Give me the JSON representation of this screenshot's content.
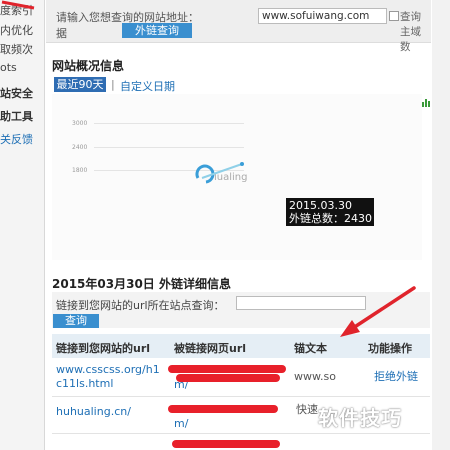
{
  "sidebar": {
    "items": [
      {
        "label": "度索引"
      },
      {
        "label": "内优化"
      },
      {
        "label": "取频次"
      },
      {
        "label": "ots"
      },
      {
        "label": "站安全"
      },
      {
        "label": "助工具"
      },
      {
        "label": "关反馈"
      }
    ]
  },
  "query_bar": {
    "label": "请输入您想查询的网站地址：",
    "url_value": "www.sofuiwang.com",
    "checkbox_label": "查询主域数",
    "data_label": "据",
    "button_label": "外链查询"
  },
  "overview": {
    "title": "网站概况信息",
    "tab_active": "最近90天",
    "tab_separator": "|",
    "tab_custom": "自定义日期",
    "tooltip_date": "2015.03.30",
    "tooltip_value": "外链总数：2430",
    "watermark_text": "lualing"
  },
  "chart_data": {
    "type": "line",
    "y_ticks": [
      "3000",
      "2400",
      "1800"
    ],
    "points": [
      {
        "x": "2015.03.30",
        "y": 2430
      }
    ],
    "title": "",
    "xlabel": "",
    "ylabel": ""
  },
  "details": {
    "title": "2015年03月30日 外链详细信息",
    "query_label": "链接到您网站的url所在站点查询：",
    "query_button": "查询",
    "columns": [
      "链接到您网站的url",
      "被链接网页url",
      "锚文本",
      "功能操作"
    ],
    "rows": [
      {
        "source_url": "www.csscss.org/h1\nc11ls.html",
        "target_url": "m/",
        "anchor": "www.so",
        "action": "拒绝外链"
      },
      {
        "source_url": "huhualing.cn/",
        "target_url": "m/",
        "anchor": "快速",
        "action": ""
      },
      {
        "source_url": "",
        "target_url": "",
        "anchor": "",
        "action": ""
      }
    ]
  },
  "branding": {
    "text": "软件技巧"
  },
  "colors": {
    "accent": "#3a8fcf",
    "tab_active": "#2f6db3",
    "link": "#1e6fb5",
    "redaction": "#e8202a",
    "arrow": "#e0242c"
  }
}
